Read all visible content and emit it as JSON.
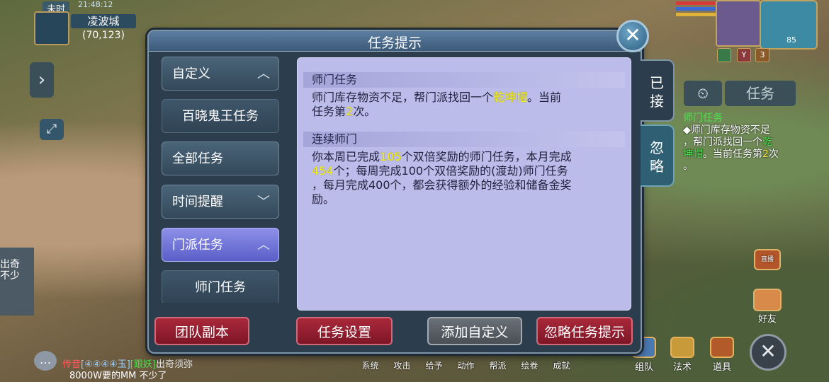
{
  "location": {
    "time_label": "未时",
    "clock": "21:48:12",
    "map_name": "凌波城",
    "coords": "(70,123)"
  },
  "player": {
    "level": "85"
  },
  "buffs": [
    "",
    "Y",
    "3"
  ],
  "tracker": {
    "tab_label": "任务",
    "title": "师门任务",
    "line1": "◆师门库存物资不足",
    "line2_pre": "，帮门派找回一个",
    "line2_item": "乾",
    "line3_item": "坤帽",
    "line3_post": "。当前任务第",
    "count": "2",
    "count_post": "次"
  },
  "dialog": {
    "title": "任务提示",
    "menu": [
      {
        "label": "自定义",
        "type": "header",
        "chevron": "up"
      },
      {
        "label": "百晓鬼王任务",
        "type": "sub"
      },
      {
        "label": "全部任务",
        "type": "header",
        "chevron": ""
      },
      {
        "label": "时间提醒",
        "type": "header",
        "chevron": "down"
      },
      {
        "label": "门派任务",
        "type": "header",
        "chevron": "up",
        "active": true
      },
      {
        "label": "师门任务",
        "type": "sub"
      }
    ],
    "sections": [
      {
        "title": "师门任务",
        "text_a": "师门库存物资不足，帮门派找回一个",
        "item": "乾坤帽",
        "text_b": "。当前",
        "text_c": "任务第",
        "count": "2",
        "text_d": "次。"
      },
      {
        "title": "连续师门",
        "t1": "你本周已完成",
        "n1": "105",
        "t2": "个双倍奖励的师门任务，本月完成",
        "n2": "454",
        "t3": "个；每周完成100个双倍奖励的(渡劫)师门任务",
        "t4": "，每月完成400个，都会获得额外的经验和储备金奖",
        "t5": "励。"
      }
    ],
    "vtabs": [
      "已接",
      "忽略"
    ],
    "buttons": {
      "team": "团队副本",
      "settings": "任务设置",
      "add_custom": "添加自定义",
      "ignore_tip": "忽略任务提示"
    }
  },
  "toolbar": [
    "系统",
    "攻击",
    "给予",
    "动作",
    "帮派",
    "绘卷",
    "成就"
  ],
  "toolbar_right": [
    "组队",
    "法术",
    "道具"
  ],
  "side_icons": {
    "friends": "好友",
    "live": "直播"
  },
  "left_sliver": [
    "出奇",
    "不少"
  ],
  "chat": {
    "channel": "传音",
    "code": "[④④④④玉]",
    "tag": "[跟妖]",
    "msg1": "出奇须弥",
    "msg2": "8000W要的MM  不少了"
  }
}
